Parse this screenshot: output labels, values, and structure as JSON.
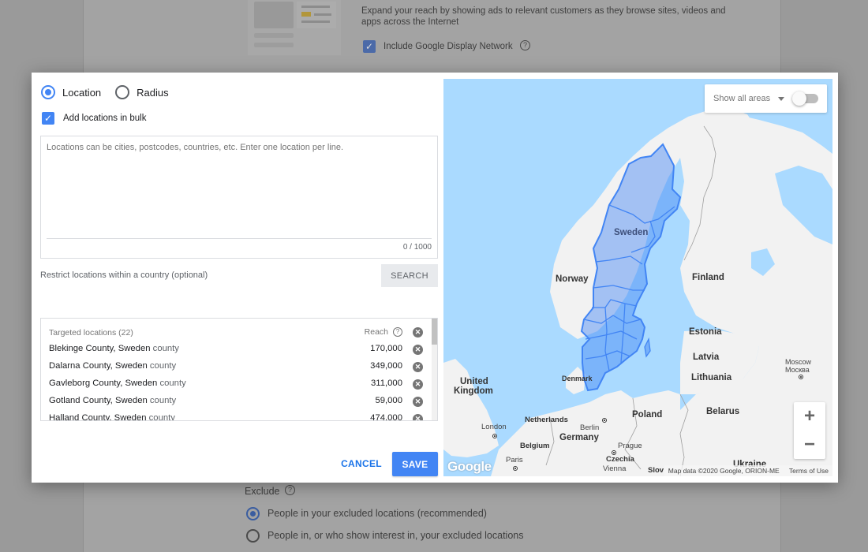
{
  "background": {
    "description": "Expand your reach by showing ads to relevant customers as they browse sites, videos and apps across the Internet",
    "display_network_label": "Include Google Display Network",
    "display_network_checked": true,
    "exclude_label": "Exclude",
    "exclude_options": [
      {
        "label": "People in your excluded locations (recommended)",
        "selected": true
      },
      {
        "label": "People in, or who show interest in, your excluded locations",
        "selected": false
      }
    ]
  },
  "modal": {
    "mode_options": [
      {
        "label": "Location",
        "selected": true
      },
      {
        "label": "Radius",
        "selected": false
      }
    ],
    "bulk": {
      "label": "Add locations in bulk",
      "checked": true
    },
    "textarea": {
      "placeholder": "Locations can be cities, postcodes, countries, etc. Enter one location per line.",
      "value": "",
      "counter": "0 / 1000"
    },
    "restrict_label": "Restrict locations within a country (optional)",
    "search_button": "SEARCH",
    "targeted": {
      "header": "Targeted locations (22)",
      "reach_header": "Reach",
      "rows": [
        {
          "name": "Blekinge County, Sweden",
          "type": "county",
          "reach": "170,000"
        },
        {
          "name": "Dalarna County, Sweden",
          "type": "county",
          "reach": "349,000"
        },
        {
          "name": "Gavleborg County, Sweden",
          "type": "county",
          "reach": "311,000"
        },
        {
          "name": "Gotland County, Sweden",
          "type": "county",
          "reach": "59,000"
        },
        {
          "name": "Halland County, Sweden",
          "type": "county",
          "reach": "474,000"
        }
      ]
    },
    "cancel_button": "CANCEL",
    "save_button": "SAVE"
  },
  "map": {
    "show_areas_label": "Show all areas",
    "show_areas_toggle": false,
    "zoom_in": "+",
    "zoom_out": "−",
    "logo": "Google",
    "attribution": "Map data ©2020 Google, ORION-ME",
    "terms": "Terms of Use",
    "highlight_color": "#4285f4",
    "labels": {
      "sweden": "Sweden",
      "norway": "Norway",
      "finland": "Finland",
      "estonia": "Estonia",
      "latvia": "Latvia",
      "lithuania": "Lithuania",
      "denmark": "Denmark",
      "uk1": "United",
      "uk2": "Kingdom",
      "netherlands": "Netherlands",
      "london": "London",
      "berlin": "Berlin",
      "germany": "Germany",
      "poland": "Poland",
      "belarus": "Belarus",
      "belgium": "Belgium",
      "prague": "Prague",
      "czechia": "Czechia",
      "paris": "Paris",
      "vienna": "Vienna",
      "slovakia": "Slov",
      "ukraine": "Ukraine",
      "moscow": "Moscow",
      "moscow_ru": "Москва"
    }
  }
}
